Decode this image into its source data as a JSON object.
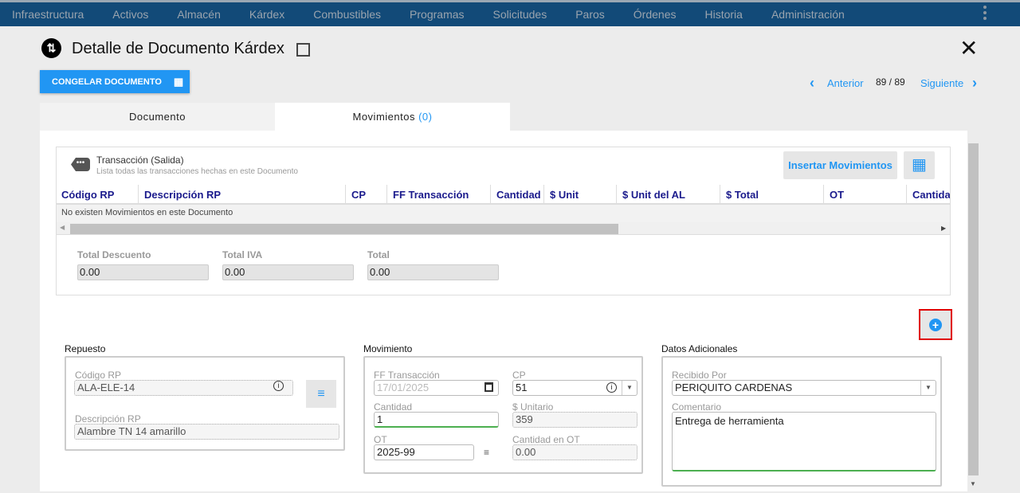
{
  "nav": {
    "items": [
      "Infraestructura",
      "Activos",
      "Almacén",
      "Kárdex",
      "Combustibles",
      "Programas",
      "Solicitudes",
      "Paros",
      "Órdenes",
      "Historia",
      "Administración"
    ]
  },
  "header": {
    "title": "Detalle de Documento Kárdex",
    "congelar_label": "CONGELAR DOCUMENTO",
    "prev": "Anterior",
    "next": "Siguiente",
    "page": "89 / 89"
  },
  "tabs": {
    "documento": "Documento",
    "movimientos": "Movimientos",
    "movimientos_count": "(0)"
  },
  "card": {
    "title": "Transacción (Salida)",
    "subtitle": "Lista todas las transacciones hechas en este Documento",
    "insert_label": "Insertar Movimientos",
    "columns": [
      "Código RP",
      "Descripción RP",
      "CP",
      "FF Transacción",
      "Cantidad",
      "$ Unit",
      "$ Unit del AL",
      "$ Total",
      "OT",
      "Cantidad"
    ],
    "empty": "No existen Movimientos en este Documento",
    "totals": [
      {
        "label": "Total Descuento",
        "value": "0.00"
      },
      {
        "label": "Total IVA",
        "value": "0.00"
      },
      {
        "label": "Total",
        "value": "0.00"
      }
    ]
  },
  "repuesto": {
    "title": "Repuesto",
    "codigo_label": "Código RP",
    "codigo": "ALA-ELE-14",
    "desc_label": "Descripción RP",
    "desc": "Alambre TN 14 amarillo"
  },
  "movimiento": {
    "title": "Movimiento",
    "ff_label": "FF Transacción",
    "ff": "17/01/2025",
    "cp_label": "CP",
    "cp": "51",
    "cantidad_label": "Cantidad",
    "cantidad": "1",
    "unitario_label": "$ Unitario",
    "unitario": "359",
    "ot_label": "OT",
    "ot": "2025-99",
    "cant_ot_label": "Cantidad en OT",
    "cant_ot": "0.00"
  },
  "adicionales": {
    "title": "Datos Adicionales",
    "recibido_label": "Recibido Por",
    "recibido": "PERIQUITO CARDENAS",
    "comentario_label": "Comentario",
    "comentario": "Entrega de herramienta"
  },
  "colors": {
    "nav": "#124a78",
    "accent": "#2196f3",
    "header_text": "#1a1a8c",
    "highlight": "#e00000",
    "focus": "#4caf50"
  }
}
